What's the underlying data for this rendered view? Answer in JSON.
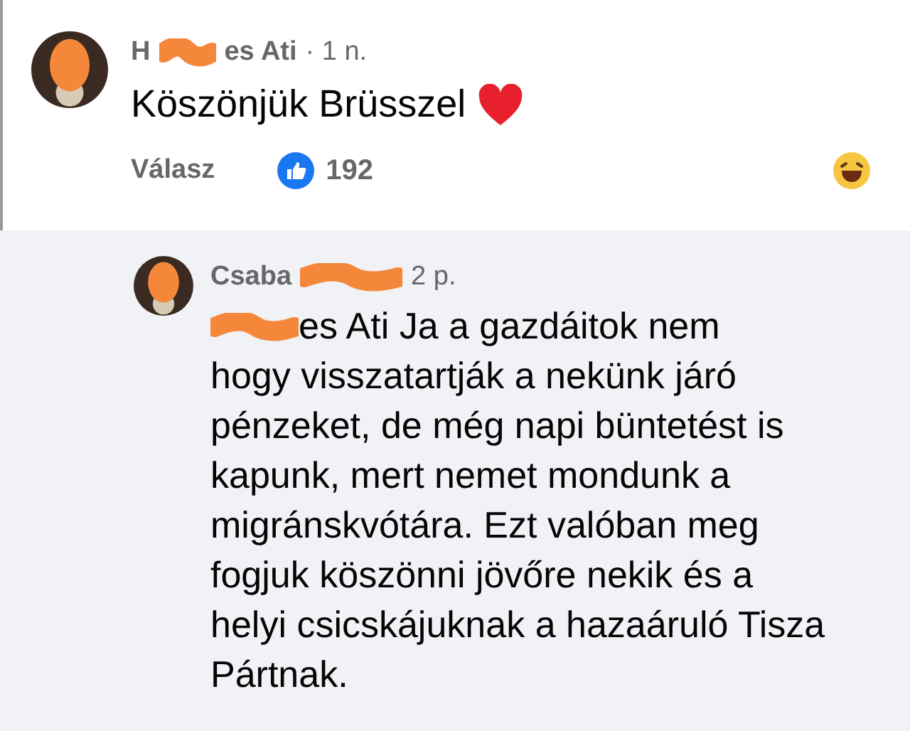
{
  "comment": {
    "author_start": "H",
    "author_end": "es Ati",
    "time": "· 1 n.",
    "text": "Köszönjük Brüsszel",
    "reply_action": "Válasz",
    "like_count": "192"
  },
  "reply": {
    "author": "Csaba",
    "time": "2 p.",
    "first_line": "es Ati Ja a gazdáitok nem",
    "text": "hogy visszatartják a nekünk járó pénzeket, de még napi büntetést is kapunk, mert nemet mondunk a migránskvótára. Ezt valóban meg fogjuk köszönni jövőre nekik és a helyi csicskájuknak a hazaáruló Tisza Pártnak."
  }
}
